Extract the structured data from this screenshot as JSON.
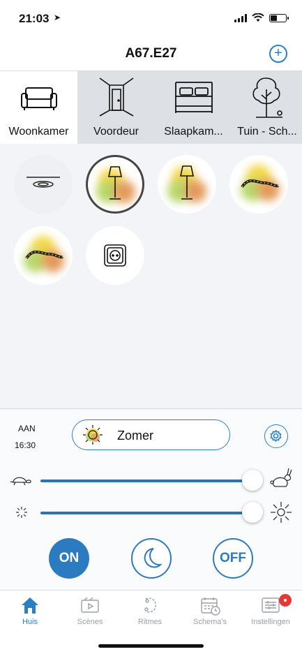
{
  "status_bar": {
    "time": "21:03"
  },
  "header": {
    "title": "A67.E27",
    "add_icon": "plus-circle-icon"
  },
  "rooms": [
    {
      "label": "Woonkamer",
      "icon": "sofa-icon",
      "active": true
    },
    {
      "label": "Voordeur",
      "icon": "door-icon",
      "active": false
    },
    {
      "label": "Slaapkam...",
      "icon": "bed-icon",
      "active": false
    },
    {
      "label": "Tuin - Sch...",
      "icon": "tree-icon",
      "active": false
    }
  ],
  "lights": [
    {
      "icon": "ceiling-light-icon",
      "state": "off"
    },
    {
      "icon": "floor-lamp-icon",
      "state": "on",
      "selected": true
    },
    {
      "icon": "floor-lamp-icon",
      "state": "on"
    },
    {
      "icon": "light-strip-icon",
      "state": "on"
    },
    {
      "icon": "light-strip-icon",
      "state": "on"
    },
    {
      "icon": "power-socket-icon",
      "state": "on"
    }
  ],
  "control": {
    "status_label": "AAN",
    "status_time": "16:30",
    "scene_name": "Zomer",
    "scene_icon": "sun-icon",
    "speed_level": 1.0,
    "brightness_level": 1.0,
    "on_label": "ON",
    "off_label": "OFF",
    "night_icon": "moon-icon",
    "accent_color": "#2b7fc3"
  },
  "tabs": [
    {
      "label": "Huis",
      "icon": "home-icon",
      "active": true
    },
    {
      "label": "Scènes",
      "icon": "scenes-icon",
      "active": false
    },
    {
      "label": "Ritmes",
      "icon": "rhythm-icon",
      "active": false
    },
    {
      "label": "Schema's",
      "icon": "calendar-icon",
      "active": false
    },
    {
      "label": "Instellingen",
      "icon": "settings-list-icon",
      "active": false,
      "badge": true
    }
  ]
}
